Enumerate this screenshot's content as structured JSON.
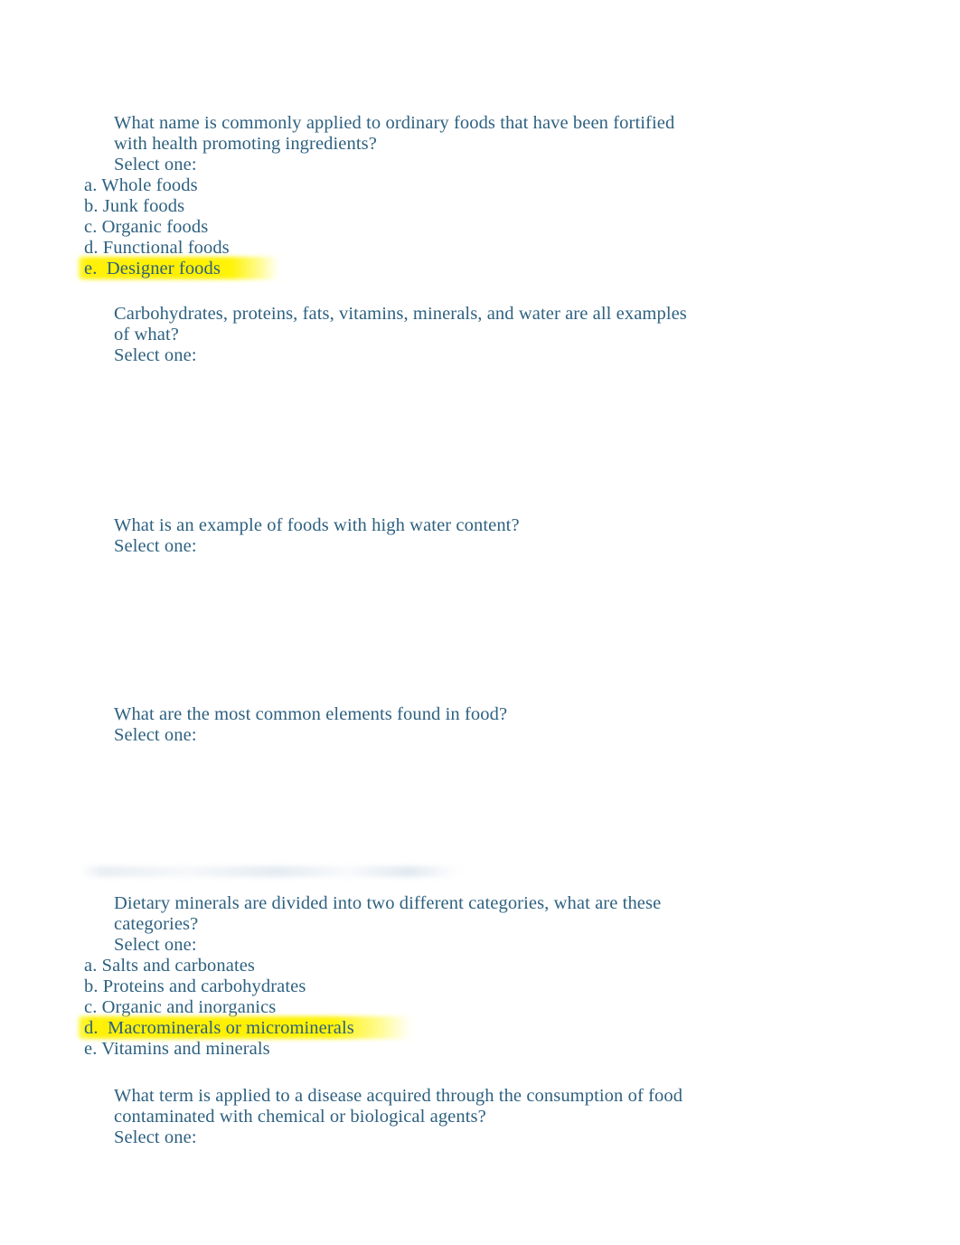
{
  "document": {
    "type": "quiz-worksheet",
    "subject_hint": "Nutrition / Food Science multiple-choice quiz",
    "text_color": "#2e6180",
    "highlight_color": "#fff000",
    "background_color": "#ffffff",
    "select_one_label": "Select one:"
  },
  "questions": [
    {
      "stem": "What name is commonly applied to ordinary foods that have been fortified with health promoting ingredients?",
      "select_label": "Select one:",
      "options": [
        {
          "label": "a. Whole foods",
          "highlighted": false
        },
        {
          "label": "b. Junk foods",
          "highlighted": false
        },
        {
          "label": "c. Organic foods",
          "highlighted": false
        },
        {
          "label": "d. Functional foods",
          "highlighted": false
        },
        {
          "label": "e.  Designer foods",
          "highlighted": true
        }
      ]
    },
    {
      "stem": "Carbohydrates, proteins, fats, vitamins, minerals, and water are all examples of what?",
      "select_label": "Select one:",
      "options": []
    },
    {
      "stem": "What is an example of foods with high water content?",
      "select_label": "Select one:",
      "options": []
    },
    {
      "stem": "What are the most common elements found in food?",
      "select_label": "Select one:",
      "options": []
    },
    {
      "stem": "Dietary minerals are divided into two different categories, what are these categories?",
      "select_label": "Select one:",
      "options": [
        {
          "label": "a. Salts and carbonates",
          "highlighted": false
        },
        {
          "label": "b. Proteins and carbohydrates",
          "highlighted": false
        },
        {
          "label": "c. Organic and inorganics",
          "highlighted": false
        },
        {
          "label": "d.  Macrominerals or microminerals",
          "highlighted": true
        },
        {
          "label": "e. Vitamins and minerals",
          "highlighted": false
        }
      ]
    },
    {
      "stem": "What term is applied to a disease acquired through the consumption of food contaminated with chemical or biological agents?",
      "select_label": "Select one:",
      "options": []
    }
  ],
  "layout": {
    "question_tops": [
      125,
      336,
      570,
      779,
      988,
      1201
    ]
  }
}
